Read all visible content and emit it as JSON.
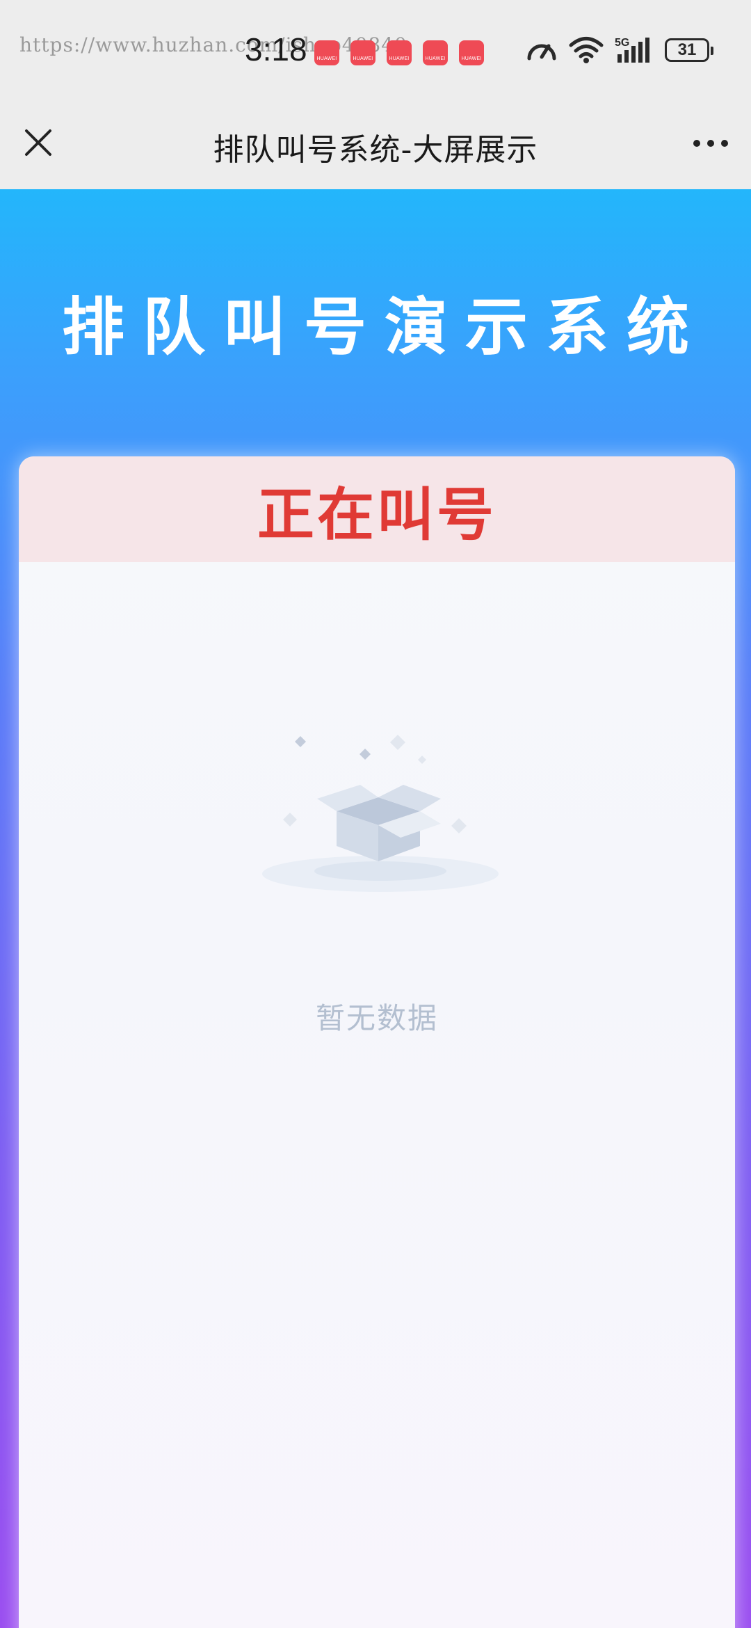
{
  "status_bar": {
    "watermark": "https://www.huzhan.com/ishop40840",
    "time": "3:18",
    "notification_label": "HUAWEI",
    "notification_count": 5,
    "network": "5G",
    "battery": "31"
  },
  "app_bar": {
    "title": "排队叫号系统-大屏展示"
  },
  "main": {
    "hero_title": "排队叫号演示系统",
    "card_title": "正在叫号",
    "empty_text": "暂无数据"
  },
  "colors": {
    "gradient_top": "#23b6fb",
    "gradient_bottom": "#9a4df0",
    "card_title": "#e03a35",
    "card_header_bg": "#f6e5e8",
    "empty_text": "#b3bfd0"
  },
  "icons": [
    "close-icon",
    "more-icon",
    "box-icon",
    "speed-icon",
    "wifi-icon",
    "signal-icon",
    "battery-icon"
  ]
}
